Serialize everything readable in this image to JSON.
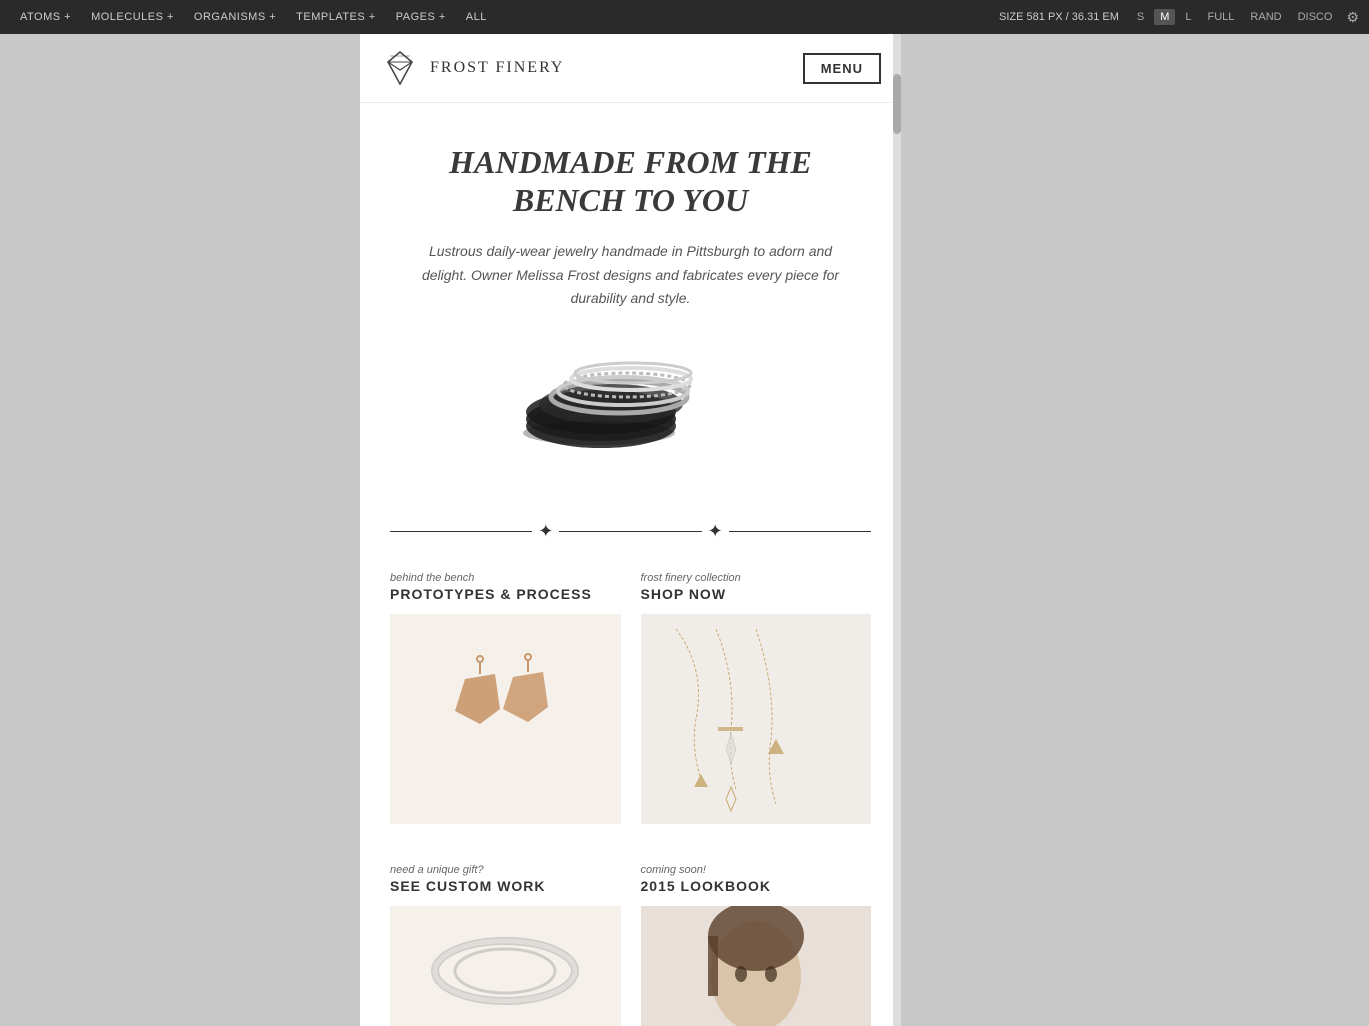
{
  "topnav": {
    "items": [
      {
        "label": "ATOMS +",
        "active": false
      },
      {
        "label": "MOLECULES +",
        "active": false
      },
      {
        "label": "ORGANISMS +",
        "active": false
      },
      {
        "label": "TEMPLATES +",
        "active": false
      },
      {
        "label": "PAGES +",
        "active": false
      },
      {
        "label": "ALL",
        "active": false
      }
    ],
    "size_info": "SIZE   581 PX / 36.31 EM",
    "size_buttons": [
      "S",
      "M",
      "L",
      "FULL",
      "RAND",
      "DISCO"
    ],
    "active_size": "M",
    "gear_icon": "⚙"
  },
  "site": {
    "logo_text": "FROST FINERY",
    "menu_label": "MENU",
    "hero_title": "HANDMADE FROM THE\nBENCH TO YOU",
    "hero_desc": "Lustrous daily-wear jewelry handmade in Pittsburgh to adorn and delight. Owner Melissa Frost designs and fabricates every piece for durability and style.",
    "sections": [
      {
        "subtitle": "behind the bench",
        "title": "PROTOTYPES & PROCESS"
      },
      {
        "subtitle": "frost finery collection",
        "title": "SHOP NOW"
      },
      {
        "subtitle": "need a unique gift?",
        "title": "SEE CUSTOM WORK"
      },
      {
        "subtitle": "coming soon!",
        "title": "2015 LOOKBOOK"
      }
    ]
  }
}
